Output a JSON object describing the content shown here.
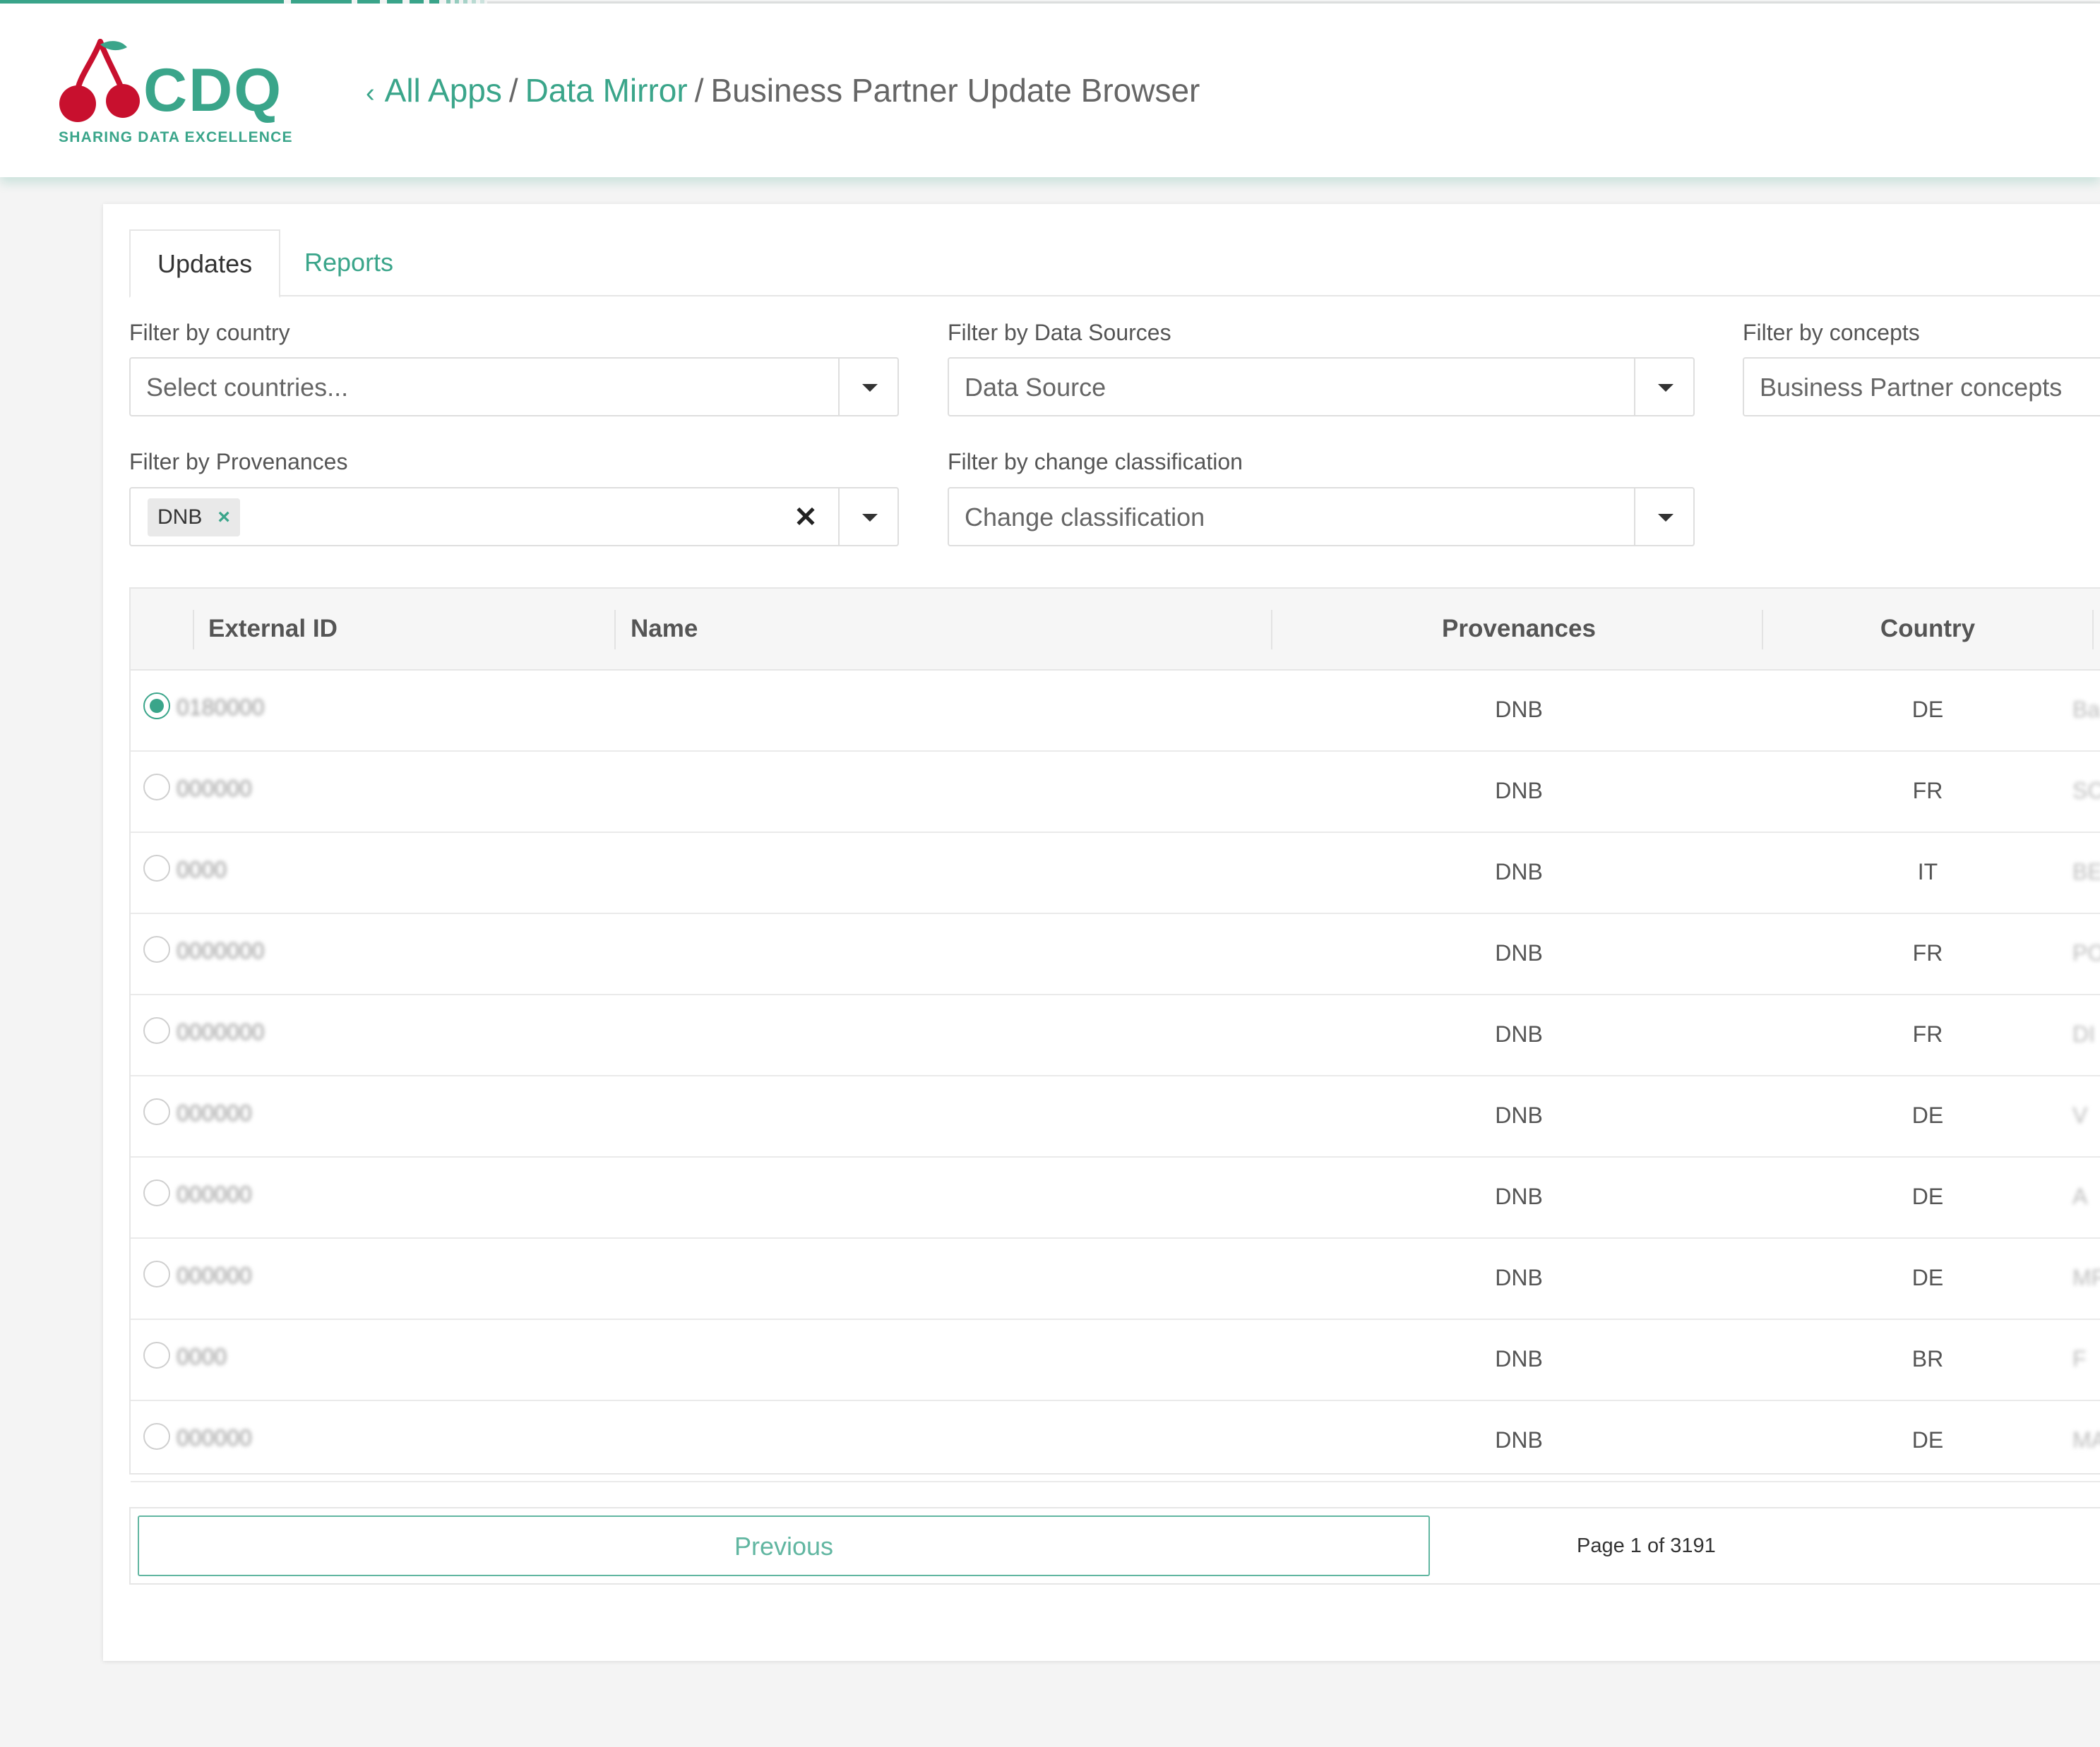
{
  "brand": {
    "name": "CDQ",
    "tagline": "SHARING DATA EXCELLENCE",
    "colors": {
      "accent": "#3aa58a",
      "cherry": "#c8102e"
    }
  },
  "breadcrumb": {
    "chevron": "‹",
    "items": [
      "All Apps",
      "Data Mirror",
      "Business Partner Update Browser"
    ],
    "separator": "/"
  },
  "tabs": [
    "Updates",
    "Reports"
  ],
  "filters": {
    "country": {
      "label": "Filter by country",
      "placeholder": "Select countries..."
    },
    "data_sources": {
      "label": "Filter by Data Sources",
      "placeholder": "Data Source"
    },
    "concepts": {
      "label": "Filter by concepts",
      "placeholder": "Business Partner concepts"
    },
    "provenances": {
      "label": "Filter by Provenances",
      "selected_chip": "DNB",
      "chip_remove": "×",
      "clear": "✕"
    },
    "change_classification": {
      "label": "Filter by change classification",
      "placeholder": "Change classification"
    }
  },
  "table": {
    "columns": [
      "External ID",
      "Name",
      "Provenances",
      "Country"
    ],
    "rows": [
      {
        "selected": true,
        "external_id": "0180000",
        "provenance": "DNB",
        "country": "DE",
        "tail": "Ba"
      },
      {
        "selected": false,
        "external_id": "000000",
        "provenance": "DNB",
        "country": "FR",
        "tail": "SCE"
      },
      {
        "selected": false,
        "external_id": "0000",
        "provenance": "DNB",
        "country": "IT",
        "tail": "BE"
      },
      {
        "selected": false,
        "external_id": "0000000",
        "provenance": "DNB",
        "country": "FR",
        "tail": "PO"
      },
      {
        "selected": false,
        "external_id": "0000000",
        "provenance": "DNB",
        "country": "FR",
        "tail": "DI"
      },
      {
        "selected": false,
        "external_id": "000000",
        "provenance": "DNB",
        "country": "DE",
        "tail": "V"
      },
      {
        "selected": false,
        "external_id": "000000",
        "provenance": "DNB",
        "country": "DE",
        "tail": "A"
      },
      {
        "selected": false,
        "external_id": "000000",
        "provenance": "DNB",
        "country": "DE",
        "tail": "MF"
      },
      {
        "selected": false,
        "external_id": "0000",
        "provenance": "DNB",
        "country": "BR",
        "tail": "F"
      },
      {
        "selected": false,
        "external_id": "000000",
        "provenance": "DNB",
        "country": "DE",
        "tail": "MA"
      }
    ]
  },
  "pager": {
    "previous_label": "Previous",
    "page_info": "Page 1 of 3191"
  }
}
